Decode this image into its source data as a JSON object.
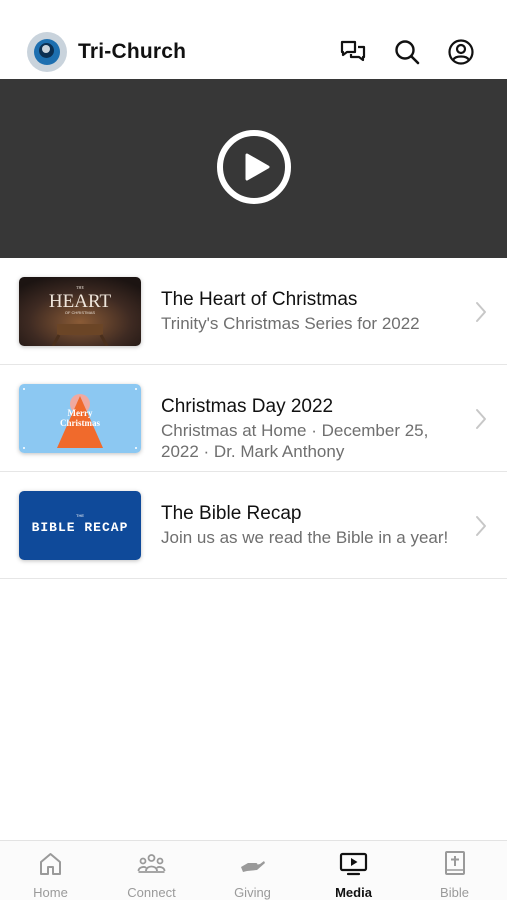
{
  "header": {
    "title": "Tri-Church",
    "logo_icon": "church-logo",
    "icons": [
      "chat-icon",
      "search-icon",
      "profile-icon"
    ]
  },
  "video": {
    "icon": "play-icon",
    "background": "#373737"
  },
  "media_items": [
    {
      "title": "The Heart of Christmas",
      "subtitle": "Trinity's Christmas Series for 2022",
      "thumb_lines": [
        "THE",
        "HEART",
        "OF CHRISTMAS"
      ]
    },
    {
      "title": "Christmas Day 2022",
      "subtitle_line1": "Christmas at Home · December 25,",
      "subtitle_line2": "2022 · Dr. Mark Anthony",
      "thumb_lines": [
        "Merry",
        "Christmas"
      ]
    },
    {
      "title": "The Bible Recap",
      "subtitle": "Join us as we read the Bible in a year!",
      "thumb_lines": [
        "THE",
        "BIBLE RECAP"
      ]
    }
  ],
  "tabs": [
    {
      "label": "Home",
      "icon": "home-icon",
      "active": false
    },
    {
      "label": "Connect",
      "icon": "people-icon",
      "active": false
    },
    {
      "label": "Giving",
      "icon": "giving-hand-icon",
      "active": false
    },
    {
      "label": "Media",
      "icon": "media-tv-icon",
      "active": true
    },
    {
      "label": "Bible",
      "icon": "bible-icon",
      "active": false
    }
  ],
  "colors": {
    "active_tab": "#111111",
    "inactive_tab": "#9a9a9a",
    "bible_recap_blue": "#0f4a9a",
    "christmas_day_sky": "#8cc8f2"
  }
}
